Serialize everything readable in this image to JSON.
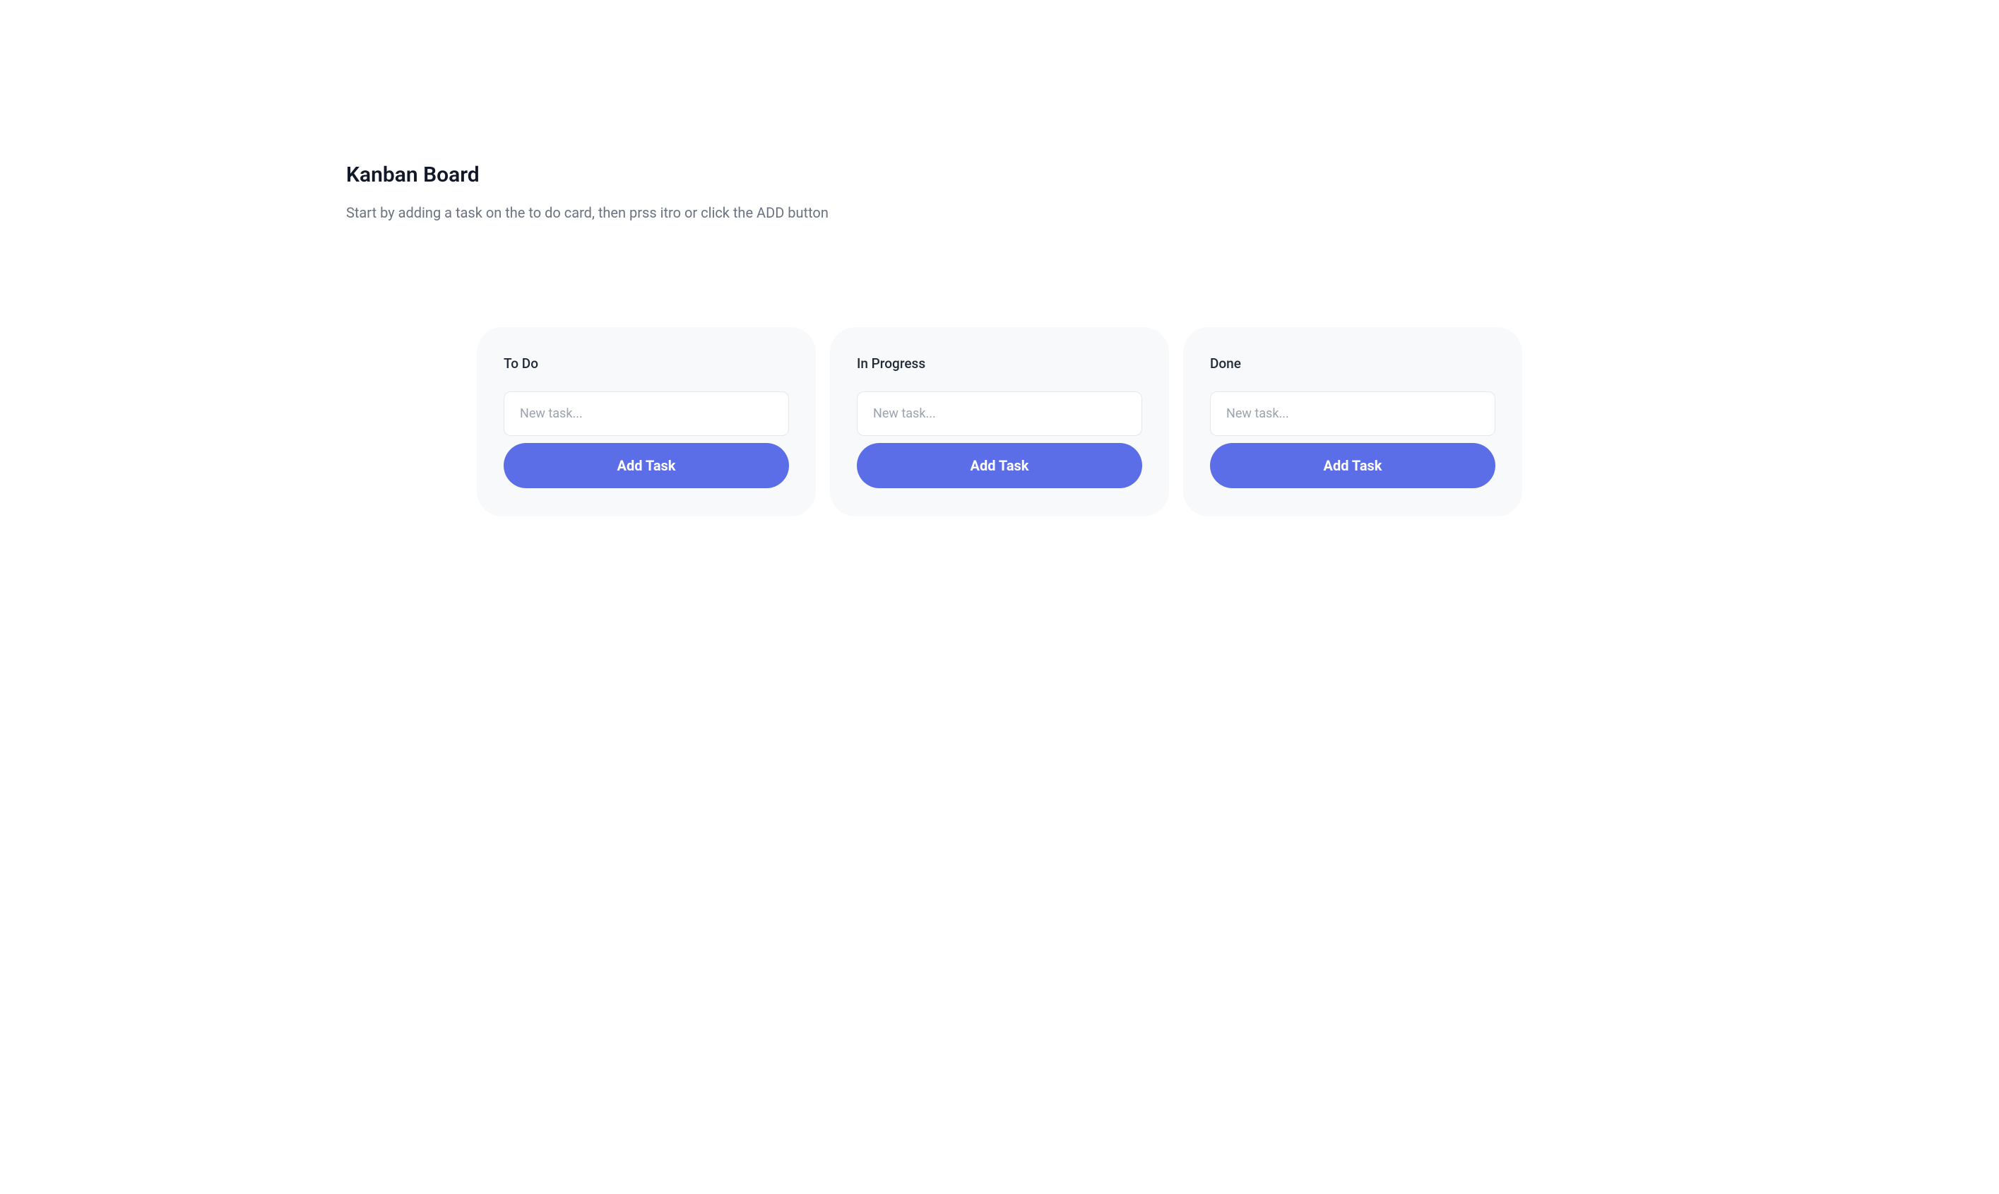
{
  "header": {
    "title": "Kanban Board",
    "subtitle": "Start by adding a task on the to do card, then prss itro or click the ADD button"
  },
  "columns": {
    "todo": {
      "title": "To Do",
      "input_placeholder": "New task...",
      "button_label": "Add Task"
    },
    "in_progress": {
      "title": "In Progress",
      "input_placeholder": "New task...",
      "button_label": "Add Task"
    },
    "done": {
      "title": "Done",
      "input_placeholder": "New task...",
      "button_label": "Add Task"
    }
  }
}
